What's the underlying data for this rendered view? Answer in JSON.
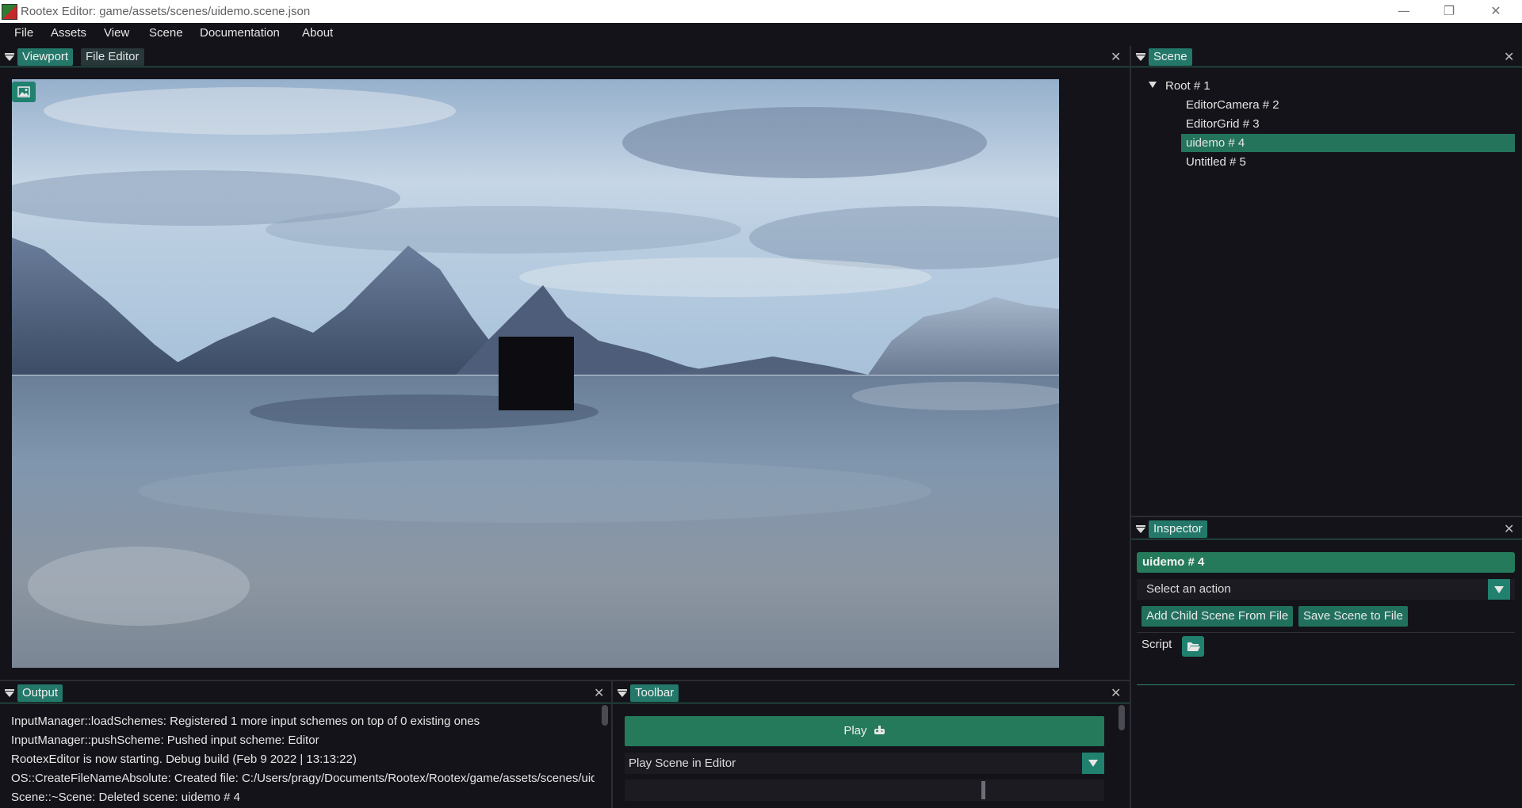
{
  "window": {
    "title": "Rootex Editor: game/assets/scenes/uidemo.scene.json",
    "minimize_glyph": "—",
    "restore_glyph": "❐",
    "close_glyph": "✕"
  },
  "menu": {
    "items": [
      {
        "label": "File"
      },
      {
        "label": "Assets"
      },
      {
        "label": "View"
      },
      {
        "label": "Scene"
      },
      {
        "label": "Documentation"
      },
      {
        "label": "About"
      }
    ]
  },
  "viewport_panel": {
    "tabs": [
      {
        "label": "Viewport",
        "active": true
      },
      {
        "label": "File Editor",
        "active": false
      }
    ],
    "close_glyph": "✕",
    "image_toggle_icon": "image-icon"
  },
  "scene_panel": {
    "tab": "Scene",
    "close_glyph": "✕",
    "tree": [
      {
        "label": "Root # 1",
        "expanded": true,
        "depth": 0
      },
      {
        "label": "EditorCamera # 2",
        "depth": 1
      },
      {
        "label": "EditorGrid # 3",
        "depth": 1
      },
      {
        "label": "uidemo # 4",
        "depth": 1,
        "selected": true
      },
      {
        "label": "Untitled # 5",
        "depth": 1
      }
    ]
  },
  "inspector_panel": {
    "tab": "Inspector",
    "close_glyph": "✕",
    "entity_name": "uidemo # 4",
    "action_select_placeholder": "Select an action",
    "buttons": {
      "add_child": "Add Child Scene From File",
      "save_scene": "Save Scene to File"
    },
    "script_label": "Script",
    "script_icon": "folder-open-icon"
  },
  "output_panel": {
    "tab": "Output",
    "close_glyph": "✕",
    "lines": [
      "InputManager::loadSchemes: Registered 1 more input schemes on top of 0 existing ones",
      "InputManager::pushScheme: Pushed input scheme: Editor",
      "RootexEditor is now starting. Debug build (Feb  9 2022 | 13:13:22)",
      "OS::CreateFileNameAbsolute: Created file: C:/Users/pragy/Documents/Rootex/Rootex/game/assets/scenes/uidemo.scene.json",
      "Scene::~Scene: Deleted scene: uidemo # 4"
    ]
  },
  "toolbar_panel": {
    "tab": "Toolbar",
    "close_glyph": "✕",
    "play_label": "Play",
    "play_icon": "gamepad-icon",
    "scene_select_value": "Play Scene in Editor"
  },
  "colors": {
    "accent": "#247a5a",
    "tab_active": "#24786a",
    "background": "#141319"
  }
}
